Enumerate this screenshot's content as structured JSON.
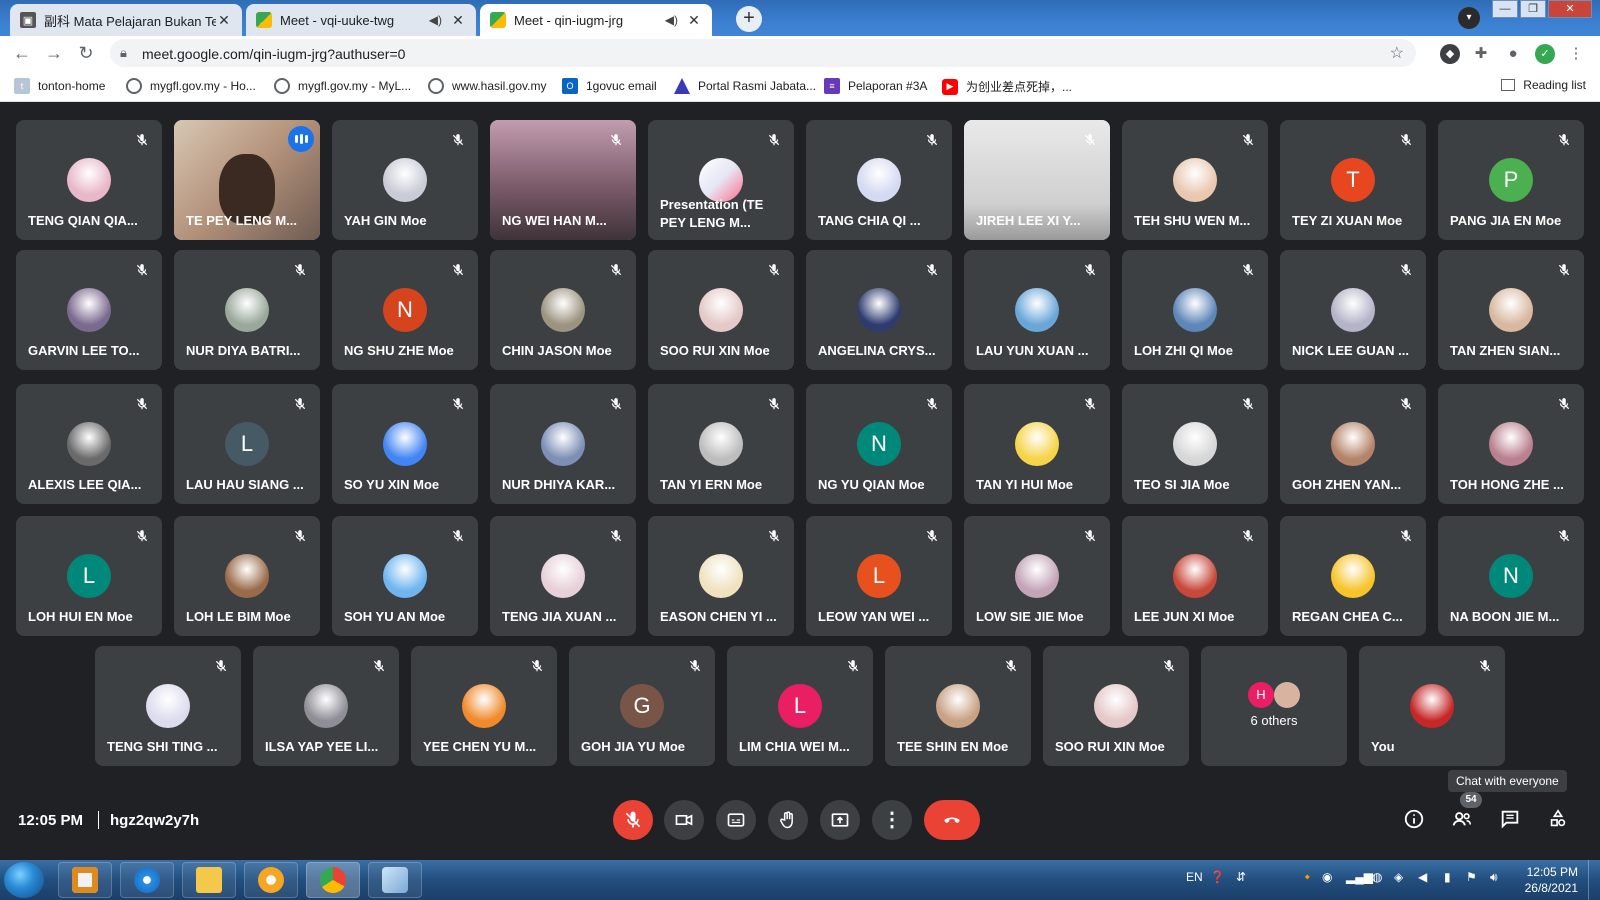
{
  "browser": {
    "tabs": [
      {
        "title": "副科 Mata Pelajaran Bukan Teras",
        "state": "inactive"
      },
      {
        "title": "Meet - vqi-uuke-twg",
        "state": "inactive"
      },
      {
        "title": "Meet - qin-iugm-jrg",
        "state": "active"
      }
    ],
    "url": "meet.google.com/qin-iugm-jrg?authuser=0",
    "bookmarks": [
      {
        "label": "tonton-home"
      },
      {
        "label": "mygfl.gov.my - Ho..."
      },
      {
        "label": "mygfl.gov.my - MyL..."
      },
      {
        "label": "www.hasil.gov.my"
      },
      {
        "label": "1govuc email"
      },
      {
        "label": "Portal Rasmi Jabata..."
      },
      {
        "label": "Pelaporan #3A"
      },
      {
        "label": "为创业差点死掉，..."
      }
    ],
    "reading_list": "Reading list"
  },
  "meet": {
    "rows": [
      [
        {
          "name": "TENG QIAN QIA...",
          "type": "avatar-img",
          "color": "#e8b7c8"
        },
        {
          "name": "TE PEY LENG M...",
          "type": "video-speaking"
        },
        {
          "name": "YAH GIN Moe",
          "type": "avatar-img",
          "color": "#c9ccd6"
        },
        {
          "name": "NG WEI HAN M...",
          "type": "video"
        },
        {
          "name": "Presentation (TE PEY LENG M...",
          "type": "presentation"
        },
        {
          "name": "TANG CHIA QI ...",
          "type": "avatar-img",
          "color": "#d5d9f2"
        },
        {
          "name": "JIREH LEE XI Y...",
          "type": "video2"
        },
        {
          "name": "TEH SHU WEN M...",
          "type": "avatar-img",
          "color": "#e9c8b0"
        },
        {
          "name": "TEY ZI XUAN Moe",
          "type": "letter",
          "letter": "T",
          "color": "#e8461e"
        },
        {
          "name": "PANG JIA EN Moe",
          "type": "letter",
          "letter": "P",
          "color": "#4caf50"
        }
      ],
      [
        {
          "name": "GARVIN LEE TO...",
          "type": "avatar-img",
          "color": "#7b6a8f"
        },
        {
          "name": "NUR DIYA BATRI...",
          "type": "avatar-img",
          "color": "#9aa89b"
        },
        {
          "name": "NG SHU ZHE Moe",
          "type": "letter",
          "letter": "N",
          "color": "#d5441c"
        },
        {
          "name": "CHIN JASON Moe",
          "type": "avatar-img",
          "color": "#9c9480"
        },
        {
          "name": "SOO RUI XIN Moe",
          "type": "avatar-img",
          "color": "#e5c8c8"
        },
        {
          "name": "ANGELINA CRYS...",
          "type": "avatar-img",
          "color": "#2d3b6e"
        },
        {
          "name": "LAU YUN XUAN ...",
          "type": "avatar-img",
          "color": "#6aa7d8"
        },
        {
          "name": "LOH ZHI QI Moe",
          "type": "avatar-img",
          "color": "#5e86b8"
        },
        {
          "name": "NICK LEE GUAN ...",
          "type": "avatar-img",
          "color": "#b4b4c8"
        },
        {
          "name": "TAN ZHEN SIAN...",
          "type": "avatar-img",
          "color": "#d8b8a0"
        }
      ],
      [
        {
          "name": "ALEXIS LEE QIA...",
          "type": "avatar-img",
          "color": "#6a6a6a"
        },
        {
          "name": "LAU HAU SIANG ...",
          "type": "letter",
          "letter": "L",
          "color": "#455a64"
        },
        {
          "name": "SO YU XIN Moe",
          "type": "avatar-img",
          "color": "#4285f4"
        },
        {
          "name": "NUR DHIYA KAR...",
          "type": "avatar-img",
          "color": "#7d8fb5"
        },
        {
          "name": "TAN YI ERN Moe",
          "type": "avatar-img",
          "color": "#bdbdbd"
        },
        {
          "name": "NG YU QIAN Moe",
          "type": "letter",
          "letter": "N",
          "color": "#00897b"
        },
        {
          "name": "TAN YI HUI Moe",
          "type": "avatar-img",
          "color": "#f6d44a"
        },
        {
          "name": "TEO SI JIA Moe",
          "type": "avatar-img",
          "color": "#d7d7d7"
        },
        {
          "name": "GOH ZHEN YAN...",
          "type": "avatar-img",
          "color": "#b5836a"
        },
        {
          "name": "TOH HONG ZHE ...",
          "type": "avatar-img",
          "color": "#b9808f"
        }
      ],
      [
        {
          "name": "LOH HUI EN Moe",
          "type": "letter",
          "letter": "L",
          "color": "#00897b"
        },
        {
          "name": "LOH LE BIM Moe",
          "type": "avatar-img",
          "color": "#9a6b4a"
        },
        {
          "name": "SOH YU AN Moe",
          "type": "avatar-img",
          "color": "#6fb6f0"
        },
        {
          "name": "TENG JIA XUAN ...",
          "type": "avatar-img",
          "color": "#e7d0d8"
        },
        {
          "name": "EASON CHEN YI ...",
          "type": "avatar-img",
          "color": "#f0e2c0"
        },
        {
          "name": "LEOW YAN WEI ...",
          "type": "letter",
          "letter": "L",
          "color": "#e8501d"
        },
        {
          "name": "LOW SIE JIE Moe",
          "type": "avatar-img",
          "color": "#c4a5b8"
        },
        {
          "name": "LEE JUN XI Moe",
          "type": "avatar-img",
          "color": "#c8483a"
        },
        {
          "name": "REGAN CHEA C...",
          "type": "avatar-img",
          "color": "#f7c42c"
        },
        {
          "name": "NA BOON JIE M...",
          "type": "letter",
          "letter": "N",
          "color": "#00897b"
        }
      ],
      [
        {
          "name": "TENG SHI TING ...",
          "type": "avatar-img",
          "color": "#dcdcee"
        },
        {
          "name": "ILSA YAP YEE LI...",
          "type": "avatar-img",
          "color": "#8f8d96"
        },
        {
          "name": "YEE CHEN YU M...",
          "type": "avatar-img",
          "color": "#f08a2c"
        },
        {
          "name": "GOH JIA YU Moe",
          "type": "letter",
          "letter": "G",
          "color": "#795548"
        },
        {
          "name": "LIM CHIA WEI M...",
          "type": "letter",
          "letter": "L",
          "color": "#e91e63"
        },
        {
          "name": "TEE SHIN EN Moe",
          "type": "avatar-img",
          "color": "#c9a184"
        },
        {
          "name": "SOO RUI XIN Moe",
          "type": "avatar-img",
          "color": "#e5c8c8"
        },
        {
          "name": "6 others",
          "type": "others",
          "letter": "H",
          "color": "#e91e63"
        },
        {
          "name": "You",
          "type": "avatar-img",
          "color": "#c62828"
        }
      ]
    ],
    "time": "12:05 PM",
    "meeting_code": "hgz2qw2y7h",
    "participant_count": "54",
    "tooltip": "Chat with everyone"
  },
  "taskbar": {
    "lang": "EN",
    "clock_time": "12:05 PM",
    "clock_date": "26/8/2021"
  }
}
